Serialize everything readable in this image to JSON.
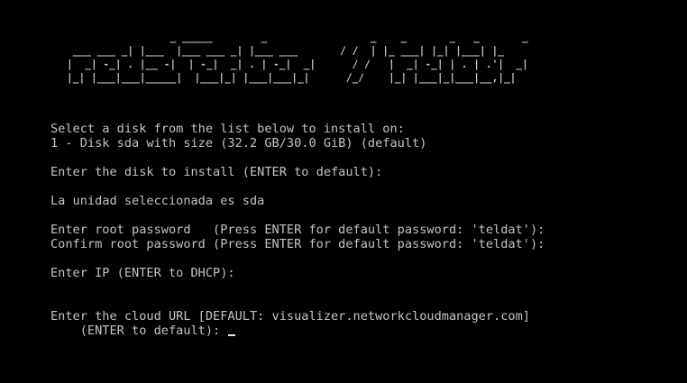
{
  "banner": {
    "ascii_art": "                 _ _____        _                 _    _       _   _       _ \n ___ ___ _| |___  |___ ___ _| |___ ___       / /  | |_ ___| |_| |___| |_ \n|  _| -_| . |__ -|  | -_|  _| . | -_|  _|      / /   |  _| -_| | . | .'|  _|\n|_| |___|___|_____|  |___|_| |___|___|_|      /_/    |_| |___|_|___|__,|_|  "
  },
  "console": {
    "select_prompt": "Select a disk from the list below to install on:",
    "disk_option": "1 - Disk sda with size (32.2 GB/30.0 GiB) (default)",
    "enter_disk": "Enter the disk to install (ENTER to default):",
    "selected_disk": "La unidad seleccionada es sda",
    "root_password": "Enter root password   (Press ENTER for default password: 'teldat'):",
    "confirm_password": "Confirm root password (Press ENTER for default password: 'teldat'):",
    "enter_ip": "Enter IP (ENTER to DHCP):",
    "cloud_url": "Enter the cloud URL [DEFAULT: visualizer.networkcloudmanager.com]",
    "cloud_url_default": "    (ENTER to default): "
  },
  "colors": {
    "background": "#000000",
    "text": "#c4c4c4",
    "cursor": "#e6e6e6"
  }
}
